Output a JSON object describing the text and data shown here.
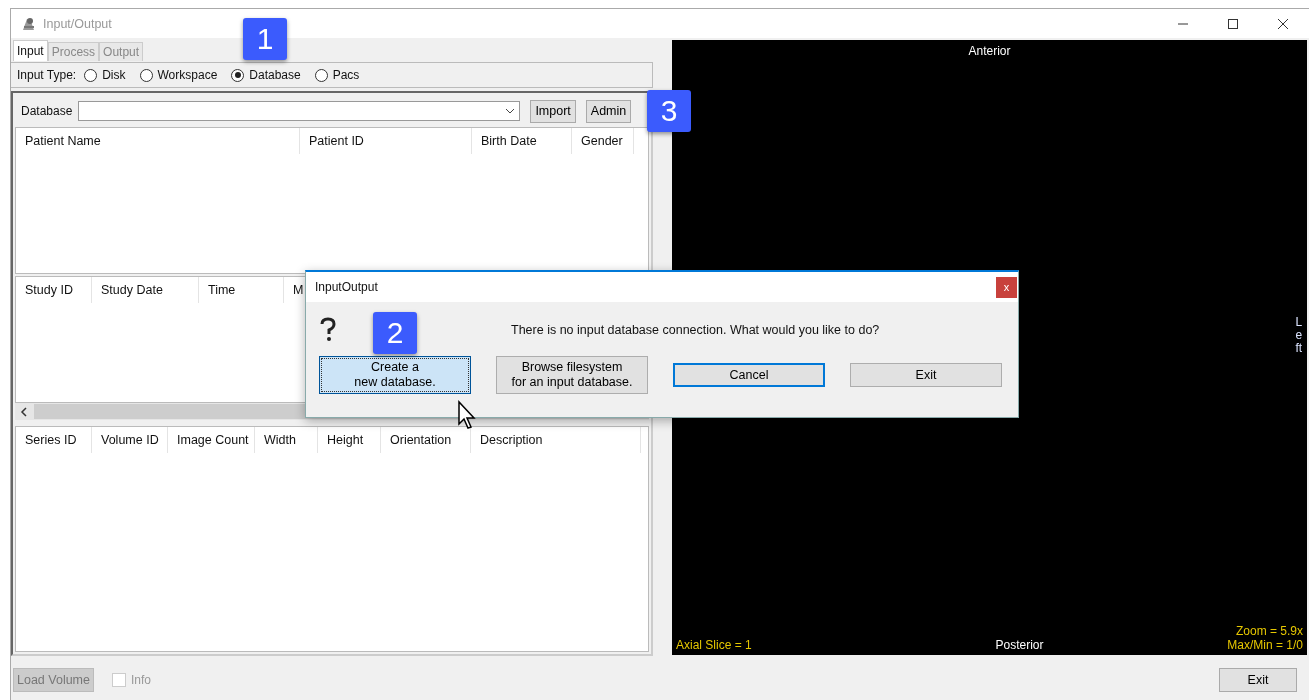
{
  "window": {
    "title": "Input/Output"
  },
  "tabs": [
    {
      "label": "Input",
      "selected": true
    },
    {
      "label": "Process",
      "selected": false
    },
    {
      "label": "Output",
      "selected": false
    }
  ],
  "input_type": {
    "label": "Input Type:",
    "options": [
      {
        "label": "Disk",
        "selected": false
      },
      {
        "label": "Workspace",
        "selected": false
      },
      {
        "label": "Database",
        "selected": true
      },
      {
        "label": "Pacs",
        "selected": false
      }
    ]
  },
  "database": {
    "label": "Database",
    "buttons": [
      "Import",
      "Admin"
    ]
  },
  "patients_table": {
    "columns": [
      "Patient Name",
      "Patient ID",
      "Birth Date",
      "Gender"
    ]
  },
  "studies_table": {
    "columns": [
      "Study ID",
      "Study Date",
      "Time",
      "M"
    ]
  },
  "series_table": {
    "columns": [
      "Series ID",
      "Volume ID",
      "Image Count",
      "Width",
      "Height",
      "Orientation",
      "Description"
    ]
  },
  "viewer": {
    "top": "Anterior",
    "bottom": "Posterior",
    "side": "Left",
    "slice": "Axial Slice = 1",
    "zoom": "Zoom = 5.9x",
    "max_min": "Max/Min = 1/0"
  },
  "bottom_bar": {
    "load_button": {
      "label": "Load Volume",
      "disabled": true
    },
    "info": {
      "label": "Info",
      "checked": false
    },
    "exit_button": "Exit"
  },
  "dialog": {
    "title": "InputOutput",
    "close": "x",
    "message": "There is no input database connection. What would you like to do?",
    "buttons": [
      {
        "label": "Create a\nnew database.",
        "kind": "hover"
      },
      {
        "label": "Browse filesystem\nfor an input database.",
        "kind": "normal"
      },
      {
        "label": "Cancel",
        "kind": "default"
      },
      {
        "label": "Exit",
        "kind": "normal"
      }
    ]
  },
  "callouts": [
    "1",
    "2",
    "3"
  ]
}
